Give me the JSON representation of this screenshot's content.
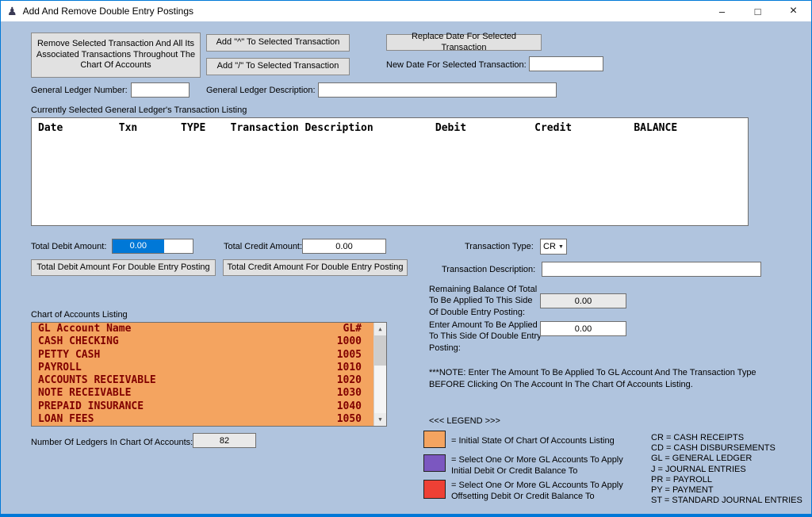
{
  "colors": {
    "window_border": "#0078D7",
    "body_bg": "#B0C4DE",
    "selection_bg": "#0078D7"
  },
  "icons": {
    "app": "♟",
    "minimize": "–",
    "maximize": "□",
    "close": "×",
    "combo_arrow": "▼",
    "scroll_up": "▲",
    "scroll_down": "▼"
  },
  "titlebar": {
    "title": "Add And Remove Double Entry Postings"
  },
  "toolbar": {
    "remove_button": "Remove Selected Transaction And All Its Associated Transactions Throughout The Chart Of Accounts",
    "add_caret_button": "Add \"^\" To Selected Transaction",
    "add_slash_button": "Add \"/\" To Selected Transaction",
    "replace_date_button": "Replace Date For Selected Transaction",
    "new_date_label": "New Date For Selected Transaction:",
    "new_date_value": ""
  },
  "general_ledger": {
    "number_label": "General Ledger Number:",
    "number_value": "",
    "description_label": "General Ledger Description:",
    "description_value": ""
  },
  "transaction_listing": {
    "label": "Currently Selected General Ledger's Transaction Listing",
    "header": "Date         Txn       TYPE    Transaction Description          Debit           Credit          BALANCE"
  },
  "totals": {
    "debit_label": "Total Debit Amount:",
    "debit_value": "0.00",
    "credit_label": "Total Credit Amount:",
    "credit_value": "0.00",
    "debit_post_button": "Total Debit Amount For Double Entry Posting",
    "credit_post_button": "Total Credit Amount For Double Entry Posting"
  },
  "entry": {
    "type_label": "Transaction Type:",
    "type_value": "CR",
    "description_label": "Transaction Description:",
    "description_value": "",
    "remaining_label": "Remaining Balance Of Total To Be Applied To This Side Of Double Entry Posting:",
    "remaining_value": "0.00",
    "amount_label": "Enter Amount To Be Applied To This Side Of Double Entry Posting:",
    "amount_value": "0.00",
    "note": "***NOTE: Enter The Amount To Be Applied To GL Account And The Transaction Type BEFORE Clicking On The Account In The Chart Of Accounts Listing."
  },
  "chart_of_accounts": {
    "label": "Chart of Accounts Listing",
    "bg": "#F4A460",
    "text_color": "#800000",
    "rows": [
      {
        "name": "GL Account Name",
        "gl": "GL#"
      },
      {
        "name": "CASH CHECKING",
        "gl": "1000"
      },
      {
        "name": "PETTY CASH",
        "gl": "1005"
      },
      {
        "name": "PAYROLL",
        "gl": "1010"
      },
      {
        "name": "ACCOUNTS RECEIVABLE",
        "gl": "1020"
      },
      {
        "name": "NOTE RECEIVABLE",
        "gl": "1030"
      },
      {
        "name": "PREPAID INSURANCE",
        "gl": "1040"
      },
      {
        "name": "LOAN FEES",
        "gl": "1050"
      }
    ],
    "count_label": "Number Of Ledgers In Chart Of Accounts:",
    "count_value": "82"
  },
  "legend": {
    "title": "<<< LEGEND >>>",
    "items": [
      {
        "color": "#F4A460",
        "label": "= Initial State Of Chart Of Accounts Listing"
      },
      {
        "color": "#7B57C0",
        "label": "= Select One Or More GL Accounts To Apply Initial Debit Or Credit Balance To"
      },
      {
        "color": "#EE4035",
        "label": "= Select One Or More GL Accounts To Apply Offsetting Debit Or Credit Balance To"
      }
    ],
    "abbreviations": [
      "CR = CASH RECEIPTS",
      "CD = CASH DISBURSEMENTS",
      "GL = GENERAL LEDGER",
      "J = JOURNAL ENTRIES",
      "PR = PAYROLL",
      "PY = PAYMENT",
      "ST = STANDARD JOURNAL ENTRIES"
    ]
  }
}
